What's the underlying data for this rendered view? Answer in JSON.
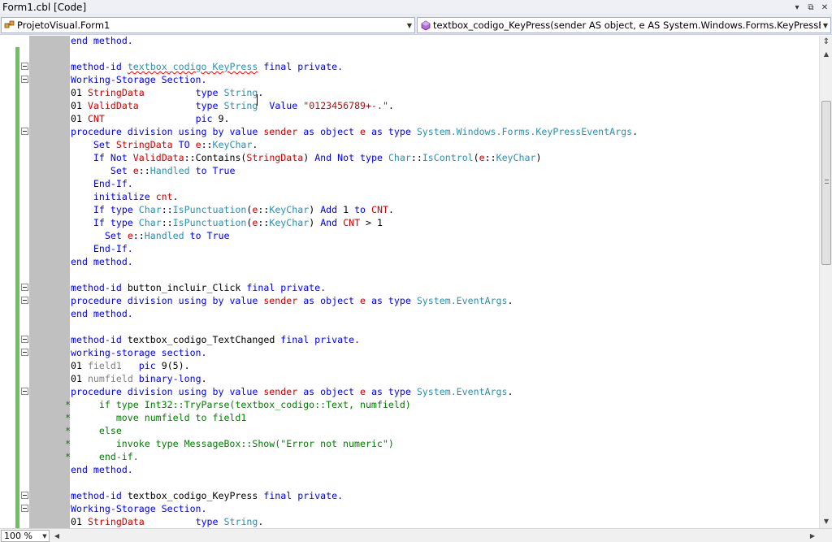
{
  "window": {
    "title": "Form1.cbl [Code]",
    "controls": [
      "▾",
      "⧉",
      "✕"
    ]
  },
  "nav": {
    "class_combo": "ProjetoVisual.Form1",
    "member_combo": "textbox_codigo_KeyPress(sender AS object, e AS System.Windows.Forms.KeyPressEventArgs)"
  },
  "status": {
    "zoom": "100 %"
  },
  "colors": {
    "keyword": "#0000ff",
    "identifier": "#d00000",
    "type": "#2b91af",
    "string": "#a31515",
    "comment": "#008000",
    "change_bar": "#6cc35c",
    "margin": "#c0c0c0"
  },
  "code": [
    {
      "fold": false,
      "segs": [
        [
          "kw",
          "end method."
        ]
      ]
    },
    {
      "fold": false,
      "segs": []
    },
    {
      "fold": true,
      "segs": [
        [
          "kw",
          "method-id "
        ],
        [
          "ty squig",
          "textbox_codigo_KeyPress"
        ],
        [
          "kw",
          " final private."
        ]
      ]
    },
    {
      "fold": true,
      "segs": [
        [
          "kw",
          "Working-Storage Section."
        ]
      ]
    },
    {
      "fold": false,
      "segs": [
        [
          "",
          "01 "
        ],
        [
          "id",
          "StringData"
        ],
        [
          "",
          "         "
        ],
        [
          "kw",
          "type "
        ],
        [
          "ty",
          "String"
        ],
        [
          "",
          "."
        ]
      ]
    },
    {
      "fold": false,
      "segs": [
        [
          "",
          "01 "
        ],
        [
          "id",
          "ValidData"
        ],
        [
          "",
          "          "
        ],
        [
          "kw",
          "type "
        ],
        [
          "ty",
          "String"
        ],
        [
          "",
          " "
        ],
        [
          "kw",
          " Value "
        ],
        [
          "st",
          "\"0123456789+-.\""
        ],
        [
          "",
          "."
        ]
      ]
    },
    {
      "fold": false,
      "segs": [
        [
          "",
          "01 "
        ],
        [
          "id",
          "CNT"
        ],
        [
          "",
          "                "
        ],
        [
          "kw",
          "pic "
        ],
        [
          "",
          "9."
        ]
      ]
    },
    {
      "fold": true,
      "segs": [
        [
          "kw",
          "procedure division using by value "
        ],
        [
          "id",
          "sender"
        ],
        [
          "kw",
          " as object "
        ],
        [
          "id",
          "e"
        ],
        [
          "kw",
          " as type "
        ],
        [
          "ty",
          "System.Windows.Forms.KeyPressEventArgs"
        ],
        [
          "",
          "."
        ]
      ]
    },
    {
      "fold": false,
      "segs": [
        [
          "",
          "    "
        ],
        [
          "kw",
          "Set "
        ],
        [
          "id",
          "StringData"
        ],
        [
          "kw",
          " TO "
        ],
        [
          "id",
          "e"
        ],
        [
          "",
          "::"
        ],
        [
          "ty",
          "KeyChar"
        ],
        [
          "",
          "."
        ]
      ]
    },
    {
      "fold": false,
      "segs": [
        [
          "",
          "    "
        ],
        [
          "kw",
          "If Not "
        ],
        [
          "id",
          "ValidData"
        ],
        [
          "",
          "::Contains("
        ],
        [
          "id",
          "StringData"
        ],
        [
          "",
          ") "
        ],
        [
          "kw",
          "And Not type "
        ],
        [
          "ty",
          "Char"
        ],
        [
          "",
          "::"
        ],
        [
          "ty",
          "IsControl"
        ],
        [
          "",
          "("
        ],
        [
          "id",
          "e"
        ],
        [
          "",
          "::"
        ],
        [
          "ty",
          "KeyChar"
        ],
        [
          "",
          ")"
        ]
      ]
    },
    {
      "fold": false,
      "segs": [
        [
          "",
          "       "
        ],
        [
          "kw",
          "Set "
        ],
        [
          "id",
          "e"
        ],
        [
          "",
          "::"
        ],
        [
          "ty",
          "Handled"
        ],
        [
          "kw",
          " to True"
        ]
      ]
    },
    {
      "fold": false,
      "segs": [
        [
          "",
          "    "
        ],
        [
          "kw",
          "End-If."
        ]
      ]
    },
    {
      "fold": false,
      "segs": [
        [
          "",
          "    "
        ],
        [
          "kw",
          "initialize "
        ],
        [
          "id",
          "cnt"
        ],
        [
          "",
          "."
        ]
      ]
    },
    {
      "fold": false,
      "segs": [
        [
          "",
          "    "
        ],
        [
          "kw",
          "If type "
        ],
        [
          "ty",
          "Char"
        ],
        [
          "",
          "::"
        ],
        [
          "ty",
          "IsPunctuation"
        ],
        [
          "",
          "("
        ],
        [
          "id",
          "e"
        ],
        [
          "",
          "::"
        ],
        [
          "ty",
          "KeyChar"
        ],
        [
          "",
          ") "
        ],
        [
          "kw",
          "Add "
        ],
        [
          "",
          "1 "
        ],
        [
          "kw",
          "to "
        ],
        [
          "id",
          "CNT"
        ],
        [
          "",
          "."
        ]
      ]
    },
    {
      "fold": false,
      "segs": [
        [
          "",
          "    "
        ],
        [
          "kw",
          "If type "
        ],
        [
          "ty",
          "Char"
        ],
        [
          "",
          "::"
        ],
        [
          "ty",
          "IsPunctuation"
        ],
        [
          "",
          "("
        ],
        [
          "id",
          "e"
        ],
        [
          "",
          "::"
        ],
        [
          "ty",
          "KeyChar"
        ],
        [
          "",
          ") "
        ],
        [
          "kw",
          "And "
        ],
        [
          "id",
          "CNT"
        ],
        [
          "",
          " > 1"
        ]
      ]
    },
    {
      "fold": false,
      "segs": [
        [
          "",
          "      "
        ],
        [
          "kw",
          "Set "
        ],
        [
          "id",
          "e"
        ],
        [
          "",
          "::"
        ],
        [
          "ty",
          "Handled"
        ],
        [
          "kw",
          " to True"
        ]
      ]
    },
    {
      "fold": false,
      "segs": [
        [
          "",
          "    "
        ],
        [
          "kw",
          "End-If."
        ]
      ]
    },
    {
      "fold": false,
      "segs": [
        [
          "kw",
          "end method."
        ]
      ]
    },
    {
      "fold": false,
      "segs": []
    },
    {
      "fold": true,
      "segs": [
        [
          "kw",
          "method-id "
        ],
        [
          "",
          "button_incluir_Click"
        ],
        [
          "kw",
          " final private."
        ]
      ]
    },
    {
      "fold": true,
      "segs": [
        [
          "kw",
          "procedure division using by value "
        ],
        [
          "id",
          "sender"
        ],
        [
          "kw",
          " as object "
        ],
        [
          "id",
          "e"
        ],
        [
          "kw",
          " as type "
        ],
        [
          "ty",
          "System.EventArgs"
        ],
        [
          "",
          "."
        ]
      ]
    },
    {
      "fold": false,
      "segs": [
        [
          "kw",
          "end method."
        ]
      ]
    },
    {
      "fold": false,
      "segs": []
    },
    {
      "fold": true,
      "segs": [
        [
          "kw",
          "method-id "
        ],
        [
          "",
          "textbox_codigo_TextChanged"
        ],
        [
          "kw",
          " final private."
        ]
      ]
    },
    {
      "fold": true,
      "segs": [
        [
          "kw",
          "working-storage section."
        ]
      ]
    },
    {
      "fold": false,
      "segs": [
        [
          "",
          "01 "
        ],
        [
          "gr",
          "field1"
        ],
        [
          "",
          "   "
        ],
        [
          "kw",
          "pic "
        ],
        [
          "",
          "9(5)."
        ]
      ]
    },
    {
      "fold": false,
      "segs": [
        [
          "",
          "01 "
        ],
        [
          "gr",
          "numfield"
        ],
        [
          "kw",
          " binary-long"
        ],
        [
          "",
          "."
        ]
      ]
    },
    {
      "fold": true,
      "segs": [
        [
          "kw",
          "procedure division using by value "
        ],
        [
          "id",
          "sender"
        ],
        [
          "kw",
          " as object "
        ],
        [
          "id",
          "e"
        ],
        [
          "kw",
          " as type "
        ],
        [
          "ty",
          "System.EventArgs"
        ],
        [
          "",
          "."
        ]
      ]
    },
    {
      "fold": false,
      "comment": true,
      "segs": [
        [
          "cm",
          "*     if type Int32::TryParse(textbox_codigo::Text, numfield)"
        ]
      ]
    },
    {
      "fold": false,
      "comment": true,
      "segs": [
        [
          "cm",
          "*        move numfield to field1"
        ]
      ]
    },
    {
      "fold": false,
      "comment": true,
      "segs": [
        [
          "cm",
          "*     else"
        ]
      ]
    },
    {
      "fold": false,
      "comment": true,
      "segs": [
        [
          "cm",
          "*        invoke type MessageBox::Show(\"Error not numeric\")"
        ]
      ]
    },
    {
      "fold": false,
      "comment": true,
      "segs": [
        [
          "cm",
          "*     end-if."
        ]
      ]
    },
    {
      "fold": false,
      "segs": [
        [
          "kw",
          "end method."
        ]
      ]
    },
    {
      "fold": false,
      "segs": []
    },
    {
      "fold": true,
      "segs": [
        [
          "kw",
          "method-id "
        ],
        [
          "",
          "textbox_codigo_KeyPress"
        ],
        [
          "kw",
          " final private."
        ]
      ]
    },
    {
      "fold": true,
      "segs": [
        [
          "kw",
          "Working-Storage Section."
        ]
      ]
    },
    {
      "fold": false,
      "segs": [
        [
          "",
          "01 "
        ],
        [
          "id",
          "StringData"
        ],
        [
          "",
          "         "
        ],
        [
          "kw",
          "type "
        ],
        [
          "ty",
          "String"
        ],
        [
          "",
          "."
        ]
      ]
    }
  ]
}
